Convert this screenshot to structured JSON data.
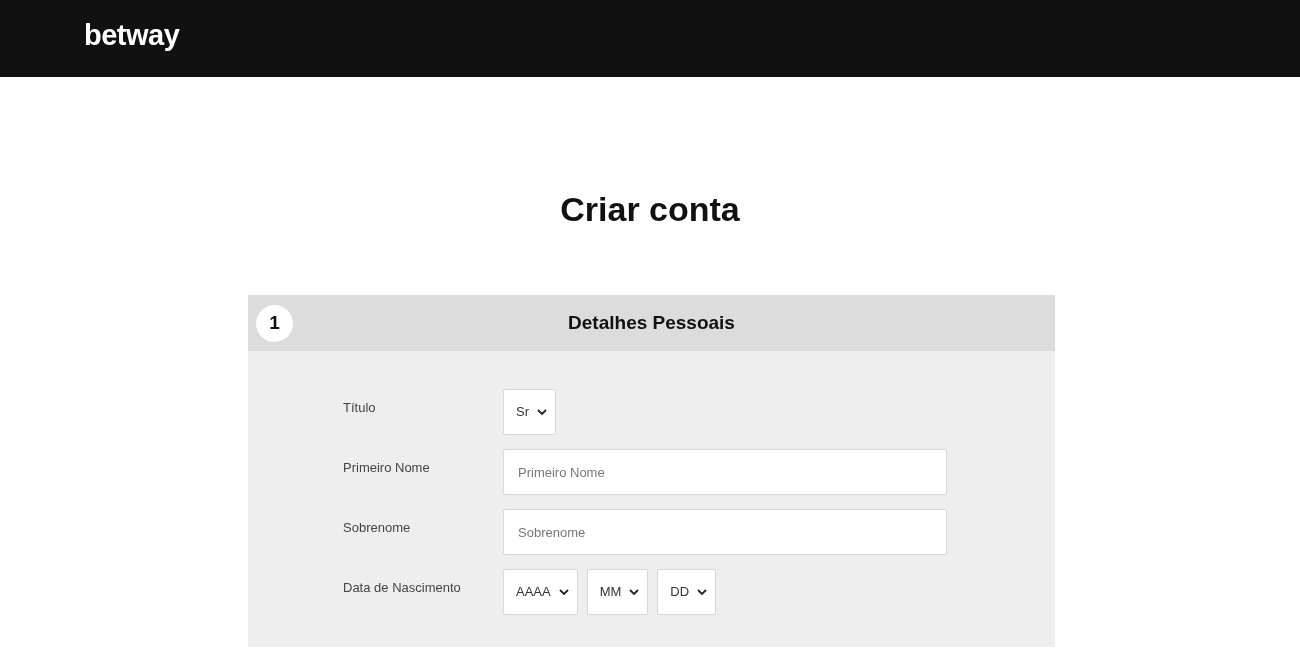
{
  "header": {
    "logo": "betway"
  },
  "heading": "Criar conta",
  "section": {
    "number": "1",
    "title": "Detalhes Pessoais",
    "rows": [
      {
        "kind": "select",
        "label": "Título",
        "selects": [
          "Sr"
        ]
      },
      {
        "kind": "text",
        "label": "Primeiro Nome",
        "placeholder": "Primeiro Nome"
      },
      {
        "kind": "text",
        "label": "Sobrenome",
        "placeholder": "Sobrenome"
      },
      {
        "kind": "select",
        "label": "Data de Nascimento",
        "selects": [
          "AAAA",
          "MM",
          "DD"
        ]
      }
    ]
  }
}
